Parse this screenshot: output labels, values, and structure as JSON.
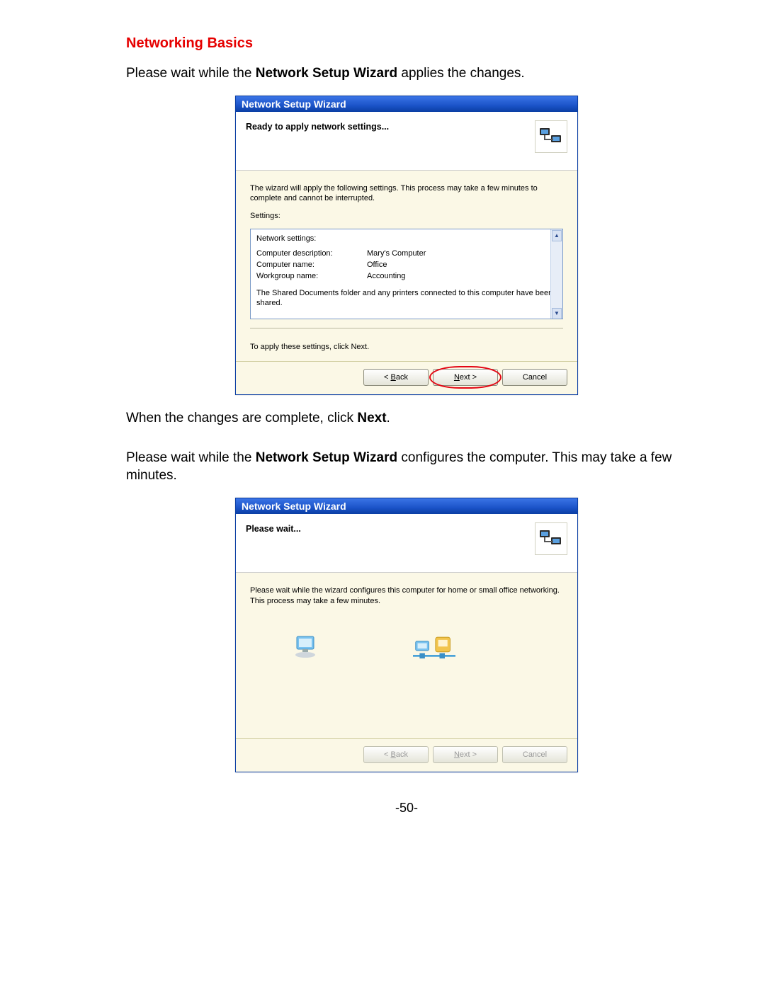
{
  "doc": {
    "section_title": "Networking Basics",
    "para1_pre": "Please wait while the ",
    "para1_bold": "Network Setup Wizard",
    "para1_post": " applies the changes.",
    "para2_pre": "When the changes are complete, click ",
    "para2_bold": "Next",
    "para2_post": ".",
    "para3_pre": "Please wait while the ",
    "para3_bold": "Network Setup Wizard",
    "para3_post": " configures the computer. This may take a few minutes.",
    "page_number": "-50-"
  },
  "wizard1": {
    "title": "Network Setup Wizard",
    "header": "Ready to apply network settings...",
    "intro": "The wizard will apply the following settings. This process may take a few minutes to complete and cannot be interrupted.",
    "settings_label": "Settings:",
    "pane": {
      "heading": "Network settings:",
      "rows": [
        {
          "key": "Computer description:",
          "val": "Mary's Computer"
        },
        {
          "key": "Computer name:",
          "val": "Office"
        },
        {
          "key": "Workgroup name:",
          "val": "Accounting"
        }
      ],
      "shared_note": "The Shared Documents folder and any printers connected to this computer have been shared."
    },
    "apply_note": "To apply these settings, click Next.",
    "buttons": {
      "back": "< Back",
      "next": "Next >",
      "cancel": "Cancel"
    }
  },
  "wizard2": {
    "title": "Network Setup Wizard",
    "header": "Please wait...",
    "intro": "Please wait while the wizard configures this computer for home or small office networking. This process may take a few minutes.",
    "buttons": {
      "back": "< Back",
      "next": "Next >",
      "cancel": "Cancel"
    }
  }
}
